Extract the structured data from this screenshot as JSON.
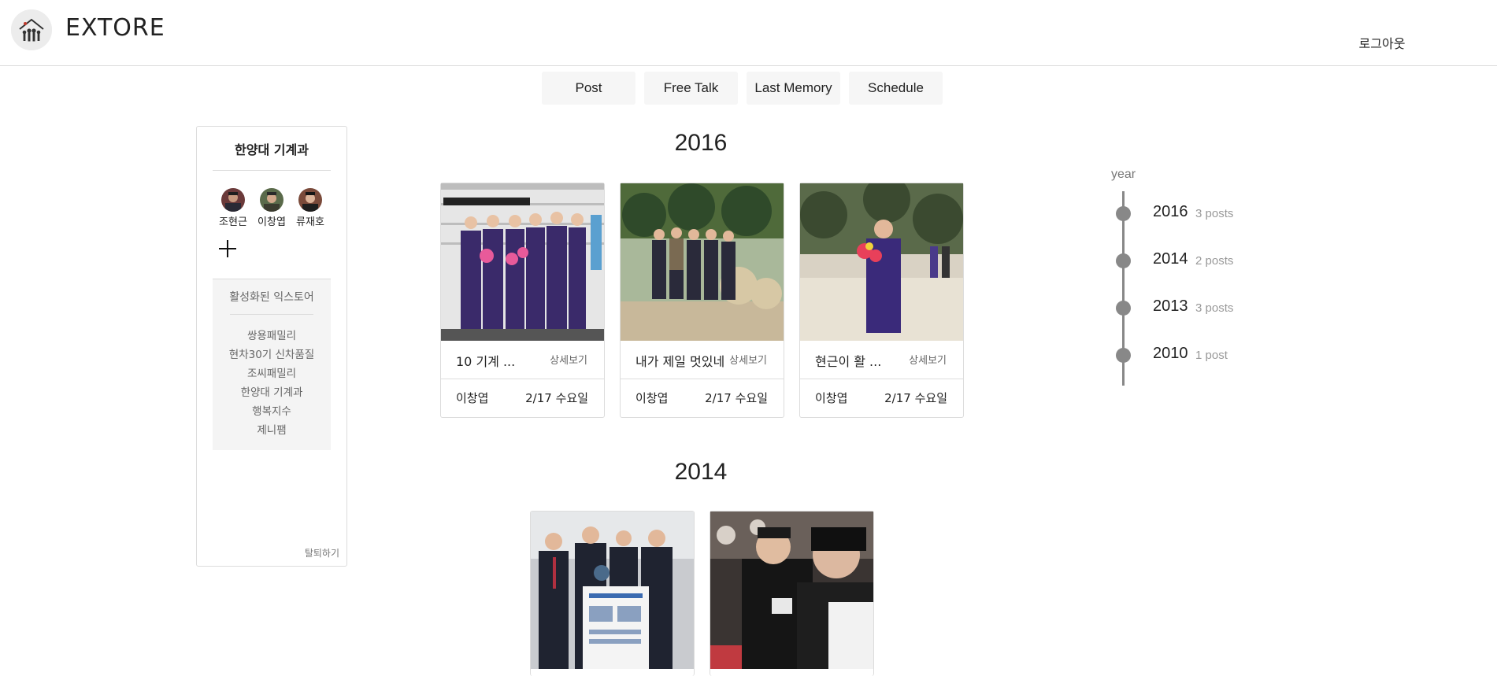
{
  "header": {
    "brand": "EXTORE",
    "logout_label": "로그아웃",
    "logo_icon": "family-house-logo-icon"
  },
  "tabs": [
    {
      "label": "Post"
    },
    {
      "label": "Free Talk"
    },
    {
      "label": "Last Memory"
    },
    {
      "label": "Schedule"
    }
  ],
  "sidebar": {
    "group_name": "한양대 기계과",
    "members": [
      {
        "name": "조현근"
      },
      {
        "name": "이창엽"
      },
      {
        "name": "류재호"
      }
    ],
    "add_icon": "plus-icon",
    "active_title": "활성화된 익스토어",
    "active_items": [
      "쌍용패밀리",
      "현차30기 신차품질",
      "조씨패밀리",
      "한양대 기계과",
      "행복지수",
      "제니팸"
    ],
    "leave_label": "탈퇴하기"
  },
  "sections": [
    {
      "year": "2016",
      "cards": [
        {
          "title": "10 기계 ...",
          "detail": "상세보기",
          "author": "이창엽",
          "date": "2/17 수요일"
        },
        {
          "title": "내가 제일 멋있네",
          "detail": "상세보기",
          "author": "이창엽",
          "date": "2/17 수요일"
        },
        {
          "title": "현근이 활 ...",
          "detail": "상세보기",
          "author": "이창엽",
          "date": "2/17 수요일"
        }
      ]
    },
    {
      "year": "2014",
      "cards": [
        {},
        {}
      ]
    }
  ],
  "timeline": {
    "label": "year",
    "items": [
      {
        "year": "2016",
        "count": "3 posts"
      },
      {
        "year": "2014",
        "count": "2 posts"
      },
      {
        "year": "2013",
        "count": "3 posts"
      },
      {
        "year": "2010",
        "count": "1 post"
      }
    ]
  },
  "colors": {
    "border": "#dcdcdc",
    "tab_bg": "#f6f6f6",
    "timeline": "#888888",
    "muted_text": "#666666"
  }
}
